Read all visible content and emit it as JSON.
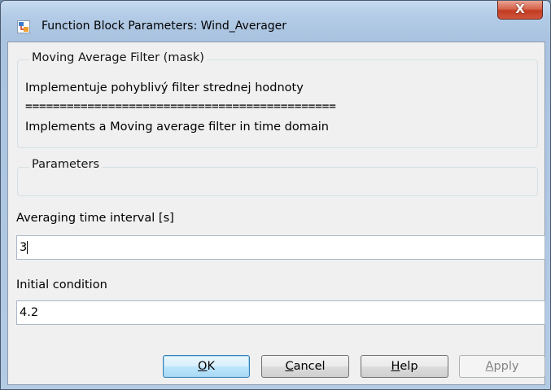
{
  "window": {
    "title": "Function Block Parameters: Wind_Averager",
    "close_glyph": "X"
  },
  "mask_group": {
    "label": "Moving Average Filter (mask)",
    "description_line1": "Implementuje pohyblivý filter strednej hodnoty",
    "separator": "=============================================",
    "description_line2": "Implements a Moving average filter in time domain"
  },
  "parameters_group": {
    "label": "Parameters"
  },
  "fields": {
    "averaging_label": "Averaging time interval [s]",
    "averaging_value": "3",
    "initial_label": "Initial condition",
    "initial_value": "4.2"
  },
  "buttons": {
    "ok": {
      "accel": "O",
      "rest": "K"
    },
    "cancel": {
      "accel": "C",
      "rest": "ancel"
    },
    "help": {
      "accel": "H",
      "rest": "elp"
    },
    "apply": {
      "accel": "A",
      "rest": "pply"
    }
  },
  "icons": {
    "title_icon": "simulink-block-icon",
    "close_icon": "close-icon"
  }
}
